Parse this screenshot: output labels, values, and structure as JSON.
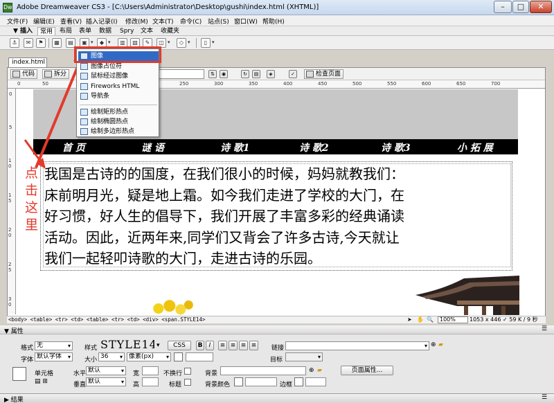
{
  "window": {
    "title": "Adobe Dreamweaver CS3 - [C:\\Users\\Administrator\\Desktop\\gushi\\index.html (XHTML)]",
    "icon_label": "Dw",
    "controls": {
      "minimize": "–",
      "maximize": "□",
      "close": "✕"
    }
  },
  "menu": [
    "文件(F)",
    "编辑(E)",
    "查看(V)",
    "插入记录(I)",
    "修改(M)",
    "文本(T)",
    "命令(C)",
    "站点(S)",
    "窗口(W)",
    "帮助(H)"
  ],
  "insert_bar": {
    "label": "▼ 插入",
    "tabs": [
      "常用",
      "布局",
      "表单",
      "数据",
      "Spry",
      "文本",
      "收藏夹"
    ],
    "active_tab": "常用"
  },
  "document": {
    "tab": "index.html",
    "toolbar": {
      "code": "代码",
      "split": "拆分",
      "check_page": "检查页面"
    }
  },
  "image_menu": {
    "items": [
      {
        "label": "图像",
        "icon": "image-icon"
      },
      {
        "label": "图像占位符",
        "icon": "image-placeholder-icon"
      },
      {
        "label": "鼠标经过图像",
        "icon": "rollover-image-icon"
      },
      {
        "label": "Fireworks HTML",
        "icon": "fireworks-icon"
      },
      {
        "label": "导航条",
        "icon": "navbar-icon"
      },
      {
        "label": "绘制矩形热点",
        "icon": "rect-hotspot-icon"
      },
      {
        "label": "绘制椭圆热点",
        "icon": "oval-hotspot-icon"
      },
      {
        "label": "绘制多边形热点",
        "icon": "polygon-hotspot-icon"
      }
    ],
    "highlighted": "图像"
  },
  "page": {
    "nav": [
      "首 页",
      "谜 语",
      "诗 歌1",
      "诗 歌2",
      "诗 歌3",
      "小 拓 展"
    ],
    "paragraph_lines": [
      "我国是古诗的的国度，在我们很小的时候，妈妈就教我们：",
      "床前明月光，疑是地上霜。如今我们走进了学校的大门，在",
      "好习惯，好人生的倡导下，我们开展了丰富多彩的经典诵读",
      "活动。因此，近两年来,同学们又背会了许多古诗,今天就让",
      "我们一起轻叩诗歌的大门，走进古诗的乐园。"
    ]
  },
  "annotation": {
    "chars": [
      "点",
      "击",
      "这",
      "里"
    ],
    "color": "#e23a2c"
  },
  "ruler": {
    "h_labels": [
      "0",
      "50",
      "100",
      "150",
      "200",
      "250",
      "300",
      "350",
      "400",
      "450",
      "500",
      "550",
      "600",
      "650",
      "700"
    ],
    "v_labels": [
      "0",
      "5",
      "1 0",
      "1 5",
      "2 0",
      "2 5",
      "3 0"
    ]
  },
  "status": {
    "tag_path": "<body> <table> <tr> <td> <table> <tr> <td> <div> <span.STYLE14>",
    "zoom": "100%",
    "size_info": "1053 x 446 ✓ 59 K / 9 秒"
  },
  "properties": {
    "header": "▼ 属性",
    "format_label": "格式",
    "format_value": "无",
    "style_label": "样式",
    "style_value": "STYLE14",
    "css_button": "CSS",
    "bold": "B",
    "italic": "I",
    "link_label": "链接",
    "font_label": "字体",
    "font_value": "默认字体",
    "size_label": "大小",
    "size_value": "36",
    "unit_value": "像素(px)",
    "target_label": "目标",
    "cell_label": "单元格",
    "horz_label": "水平",
    "horz_value": "默认",
    "width_label": "宽",
    "nowrap_label": "不换行",
    "bg_label": "背景",
    "page_props_button": "页面属性...",
    "vert_label": "垂直",
    "vert_value": "默认",
    "height_label": "高",
    "header_label": "标题",
    "bgcolor_label": "背景颜色",
    "border_label": "边框",
    "alignment_icons": [
      "align-left-icon",
      "align-center-icon",
      "align-right-icon",
      "align-justify-icon"
    ]
  },
  "results_panel": {
    "label": "▶ 结果"
  }
}
